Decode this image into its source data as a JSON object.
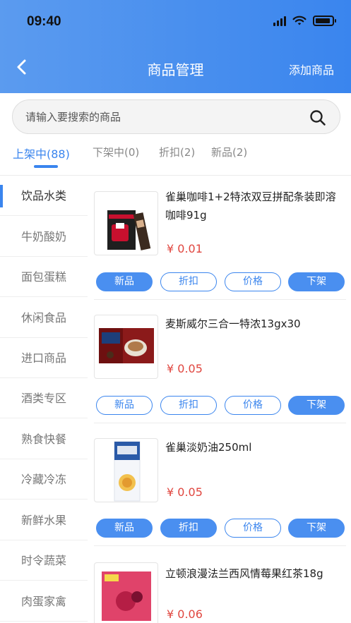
{
  "status_bar": {
    "time": "09:40"
  },
  "header": {
    "title": "商品管理",
    "add_label": "添加商品"
  },
  "search": {
    "placeholder": "请输入要搜索的商品"
  },
  "tabs": [
    {
      "label": "上架中(88)",
      "active": true
    },
    {
      "label": "下架中(0)",
      "active": false
    },
    {
      "label": "折扣(2)",
      "active": false
    },
    {
      "label": "新品(2)",
      "active": false
    }
  ],
  "categories": [
    {
      "label": "饮品水类",
      "active": true
    },
    {
      "label": "牛奶酸奶"
    },
    {
      "label": "面包蛋糕"
    },
    {
      "label": "休闲食品"
    },
    {
      "label": "进口商品"
    },
    {
      "label": "酒类专区"
    },
    {
      "label": "熟食快餐"
    },
    {
      "label": "冷藏冷冻"
    },
    {
      "label": "新鲜水果"
    },
    {
      "label": "时令蔬菜"
    },
    {
      "label": "肉蛋家禽"
    }
  ],
  "product_buttons": {
    "new": "新品",
    "discount": "折扣",
    "price": "价格",
    "off_shelf": "下架"
  },
  "products": [
    {
      "name": "雀巢咖啡1+2特浓双豆拼配条装即溶咖啡91g",
      "price": "¥ 0.01",
      "new_active": true,
      "discount_active": false,
      "price_active": false
    },
    {
      "name": "麦斯威尔三合一特浓13gx30",
      "price": "¥ 0.05",
      "new_active": false,
      "discount_active": false,
      "price_active": false
    },
    {
      "name": "雀巢淡奶油250ml",
      "price": "¥ 0.05",
      "new_active": true,
      "discount_active": true,
      "price_active": false
    },
    {
      "name": "立顿浪漫法兰西风情莓果红茶18g",
      "price": "¥ 0.06"
    }
  ],
  "colors": {
    "primary": "#3a85ee",
    "price": "#e0463f"
  }
}
